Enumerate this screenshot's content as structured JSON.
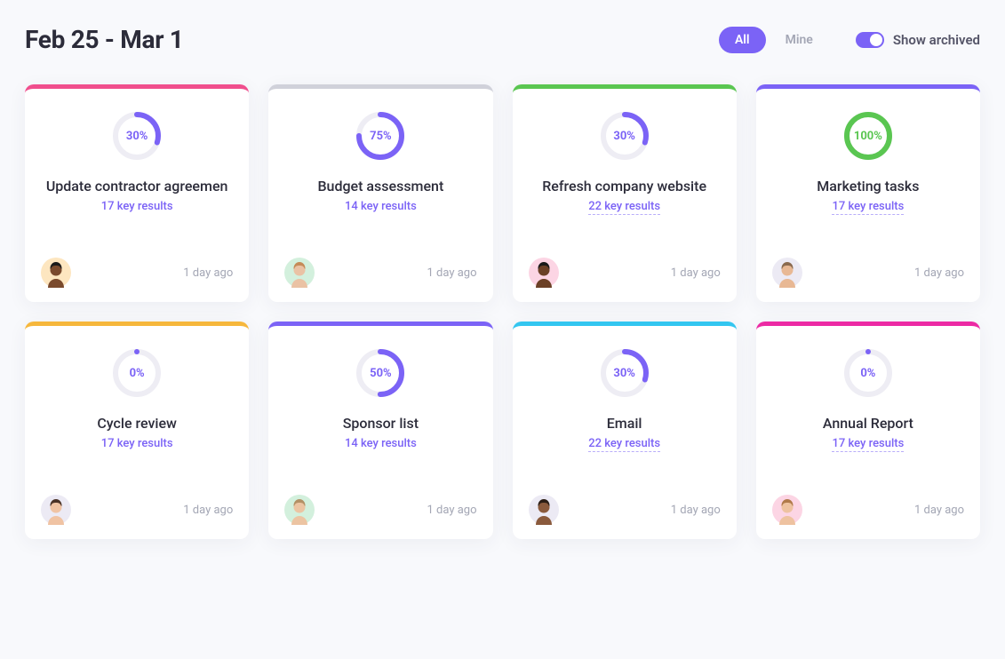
{
  "header": {
    "title": "Feb 25 - Mar 1",
    "filters": {
      "all": "All",
      "mine": "Mine"
    },
    "toggle_label": "Show archived"
  },
  "colors": {
    "purple": "#7b63f6",
    "green": "#5ac651",
    "track": "#eeedf4"
  },
  "cards": [
    {
      "accent": "#f04e8d",
      "percent": 30,
      "ring_color": "#7b63f6",
      "title": "Update contractor agreemen",
      "sub": "17 key results",
      "underline": false,
      "time": "1 day ago",
      "avatar_bg": "#fde6c0",
      "avatar_skin": "#7a4a2d",
      "avatar_hair": "#1a1a1a"
    },
    {
      "accent": "#d0d1da",
      "percent": 75,
      "ring_color": "#7b63f6",
      "title": "Budget assessment",
      "sub": "14 key results",
      "underline": false,
      "time": "1 day ago",
      "avatar_bg": "#d3f0dd",
      "avatar_skin": "#eac2a4",
      "avatar_hair": "#c58b58"
    },
    {
      "accent": "#5ac651",
      "percent": 30,
      "ring_color": "#7b63f6",
      "title": "Refresh company website",
      "sub": "22 key results",
      "underline": true,
      "time": "1 day ago",
      "avatar_bg": "#fcd5e4",
      "avatar_skin": "#6b4026",
      "avatar_hair": "#1a1a1a"
    },
    {
      "accent": "#7b63f6",
      "percent": 100,
      "ring_color": "#5ac651",
      "title": "Marketing tasks",
      "sub": "17 key results",
      "underline": true,
      "time": "1 day ago",
      "avatar_bg": "#eceaf4",
      "avatar_skin": "#e8b894",
      "avatar_hair": "#8a6a4e"
    },
    {
      "accent": "#f6b73c",
      "percent": 0,
      "ring_color": "#7b63f6",
      "title": "Cycle review",
      "sub": "17 key results",
      "underline": false,
      "time": "1 day ago",
      "avatar_bg": "#eceaf4",
      "avatar_skin": "#f0c3a3",
      "avatar_hair": "#4a3226"
    },
    {
      "accent": "#7b63f6",
      "percent": 50,
      "ring_color": "#7b63f6",
      "title": "Sponsor list",
      "sub": "14 key results",
      "underline": false,
      "time": "1 day ago",
      "avatar_bg": "#d3f0dd",
      "avatar_skin": "#ecc4a2",
      "avatar_hair": "#b39065"
    },
    {
      "accent": "#33c6f0",
      "percent": 30,
      "ring_color": "#7b63f6",
      "title": "Email",
      "sub": "22 key results",
      "underline": true,
      "time": "1 day ago",
      "avatar_bg": "#eceaf4",
      "avatar_skin": "#8a5a3c",
      "avatar_hair": "#2b1d14"
    },
    {
      "accent": "#ec2aa4",
      "percent": 0,
      "ring_color": "#7b63f6",
      "title": "Annual Report",
      "sub": "17 key results",
      "underline": true,
      "time": "1 day ago",
      "avatar_bg": "#fcd5e4",
      "avatar_skin": "#eec2a0",
      "avatar_hair": "#b07a4a"
    }
  ]
}
